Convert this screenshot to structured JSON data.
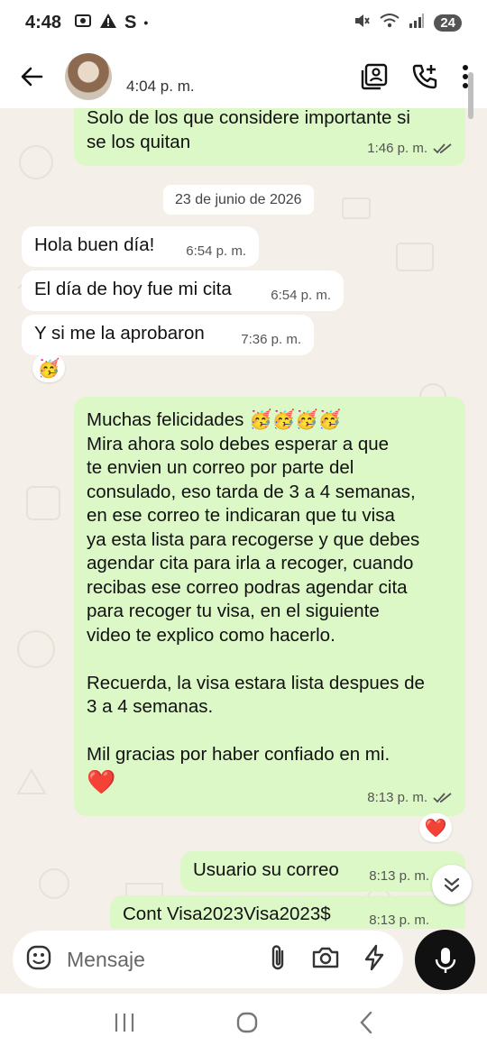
{
  "status_bar": {
    "time": "4:48",
    "battery": "24",
    "icons": [
      "screenshot-icon",
      "alert-icon",
      "s-app-icon",
      "dot-icon",
      "mute-icon",
      "wifi-icon",
      "signal-icon",
      "battery-icon"
    ]
  },
  "header": {
    "last_seen": "4:04 p. m.",
    "icons": [
      "back-arrow-icon",
      "contact-card-icon",
      "add-call-icon",
      "more-vertical-icon"
    ]
  },
  "chat": {
    "date_chip": "23 de junio de 2026",
    "messages": [
      {
        "direction": "out",
        "lines": [
          "Solo de los que considere importante si",
          "se los quitan"
        ],
        "time": "1:46 p. m.",
        "status": "read"
      },
      {
        "direction": "in",
        "text": "Hola buen día!",
        "time": "6:54 p. m."
      },
      {
        "direction": "in",
        "text": "El día de hoy fue mi cita",
        "time": "6:54 p. m."
      },
      {
        "direction": "in",
        "text": "Y si me la aprobaron",
        "time": "7:36 p. m.",
        "reaction": "🥳"
      },
      {
        "direction": "out",
        "lines": [
          "Muchas felicidades 🥳🥳🥳🥳",
          "Mira ahora solo debes esperar a que",
          "te envien un correo por parte del",
          "consulado, eso tarda de 3 a 4 semanas,",
          "en ese correo te indicaran que tu visa",
          "ya esta lista para recogerse y que debes",
          "agendar cita para irla a recoger, cuando",
          "recibas ese correo podras agendar cita",
          "para recoger tu visa, en el siguiente",
          "video te explico como hacerlo.",
          "",
          "Recuerda, la visa estara lista despues de",
          "3 a 4 semanas.",
          "",
          "Mil gracias por haber confiado en mi.",
          "❤️"
        ],
        "time": "8:13 p. m.",
        "status": "read",
        "reaction": "❤️"
      },
      {
        "direction": "out",
        "text": "Usuario su correo",
        "time": "8:13 p. m."
      },
      {
        "direction": "out",
        "text": "Cont Visa2023Visa2023$",
        "time": "8:13 p. m."
      }
    ]
  },
  "composer": {
    "placeholder": "Mensaje",
    "icons": [
      "emoji-icon",
      "attach-icon",
      "camera-icon",
      "bolt-icon",
      "mic-icon"
    ]
  },
  "nav_bar": {
    "icons": [
      "recents-icon",
      "home-icon",
      "back-icon"
    ]
  },
  "colors": {
    "outgoing_bubble": "#dcf8c6",
    "incoming_bubble": "#ffffff",
    "chat_background": "#f4efe8",
    "mic_button": "#111111"
  }
}
